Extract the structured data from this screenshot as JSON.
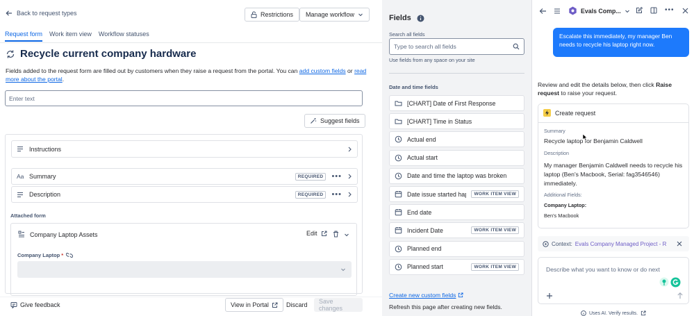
{
  "left": {
    "back_label": "Back to request types",
    "restrictions_label": "Restrictions",
    "manage_workflow_label": "Manage workflow",
    "tabs": [
      {
        "label": "Request form"
      },
      {
        "label": "Work item view"
      },
      {
        "label": "Workflow statuses"
      }
    ],
    "title": "Recycle current company hardware",
    "description_prefix": "Fields added to the request form are filled out by customers when they raise a request from the portal. You can ",
    "description_link1": "add custom fields",
    "description_or": " or ",
    "description_link2": "read more about the portal",
    "description_suffix": ".",
    "text_placeholder": "Enter text",
    "suggest_fields_label": "Suggest fields",
    "rows": [
      {
        "label": "Instructions"
      },
      {
        "label": "Summary",
        "badge": "REQUIRED"
      },
      {
        "label": "Description",
        "badge": "REQUIRED"
      }
    ],
    "attached_form_label": "Attached form",
    "laptop_assets_label": "Company Laptop Assets",
    "edit_label": "Edit",
    "company_laptop_label": "Company Laptop",
    "required_star": "*",
    "footer": {
      "feedback_label": "Give feedback",
      "view_portal_label": "View in Portal",
      "discard_label": "Discard",
      "save_label": "Save changes"
    }
  },
  "fields": {
    "title": "Fields",
    "search_label": "Search all fields",
    "search_placeholder": "Type to search all fields",
    "search_hint": "Use fields from any space on your site",
    "section_label": "Date and time fields",
    "items": [
      {
        "label": "[CHART] Date of First Response",
        "icon": "folder-icon"
      },
      {
        "label": "[CHART] Time in Status",
        "icon": "folder-icon"
      },
      {
        "label": "Actual end",
        "icon": "clock-icon"
      },
      {
        "label": "Actual start",
        "icon": "clock-icon"
      },
      {
        "label": "Date and time the laptop was broken",
        "icon": "clock-icon"
      },
      {
        "label": "Date issue started happ",
        "icon": "calendar-icon",
        "badge": "WORK ITEM VIEW"
      },
      {
        "label": "End date",
        "icon": "calendar-icon"
      },
      {
        "label": "Incident Date",
        "icon": "calendar-icon",
        "badge": "WORK ITEM VIEW"
      },
      {
        "label": "Planned end",
        "icon": "clock-icon"
      },
      {
        "label": "Planned start",
        "icon": "clock-icon",
        "badge": "WORK ITEM VIEW"
      }
    ],
    "create_link": "Create new custom fields",
    "refresh_note": "Refresh this page after creating new fields."
  },
  "assistant": {
    "agent_name": "Evals Comp...",
    "user_message": "Escalate this immediately, my manager Ben needs to recycle his laptop right now.",
    "reply_prefix": "Review and edit the details below, then click ",
    "reply_bold": "Raise request",
    "reply_suffix": " to raise your request.",
    "card": {
      "title": "Create request",
      "summary_label": "Summary",
      "summary_value": "Recycle laptop for Benjamin Caldwell",
      "description_label": "Description",
      "description_value": "My manager Benjamin Caldwell needs to recycle his laptop (Ben's Macbook, Serial: fag3546546) immediately.",
      "additional_label": "Additional Fields:",
      "laptop_label": "Company Laptop:",
      "laptop_value": "Ben's Macbook"
    },
    "context_prefix": "Context:",
    "context_value": "Evals Company Managed Project - R",
    "chat_placeholder": "Describe what you want to know or do next",
    "disclaimer": "Uses AI. Verify results."
  },
  "colors": {
    "accent": "#0c66e4",
    "bubble": "#1d7afc",
    "agent_purple": "#6e5dc6",
    "lightning": "#f5cd47",
    "grammarly": "#15c39a"
  }
}
